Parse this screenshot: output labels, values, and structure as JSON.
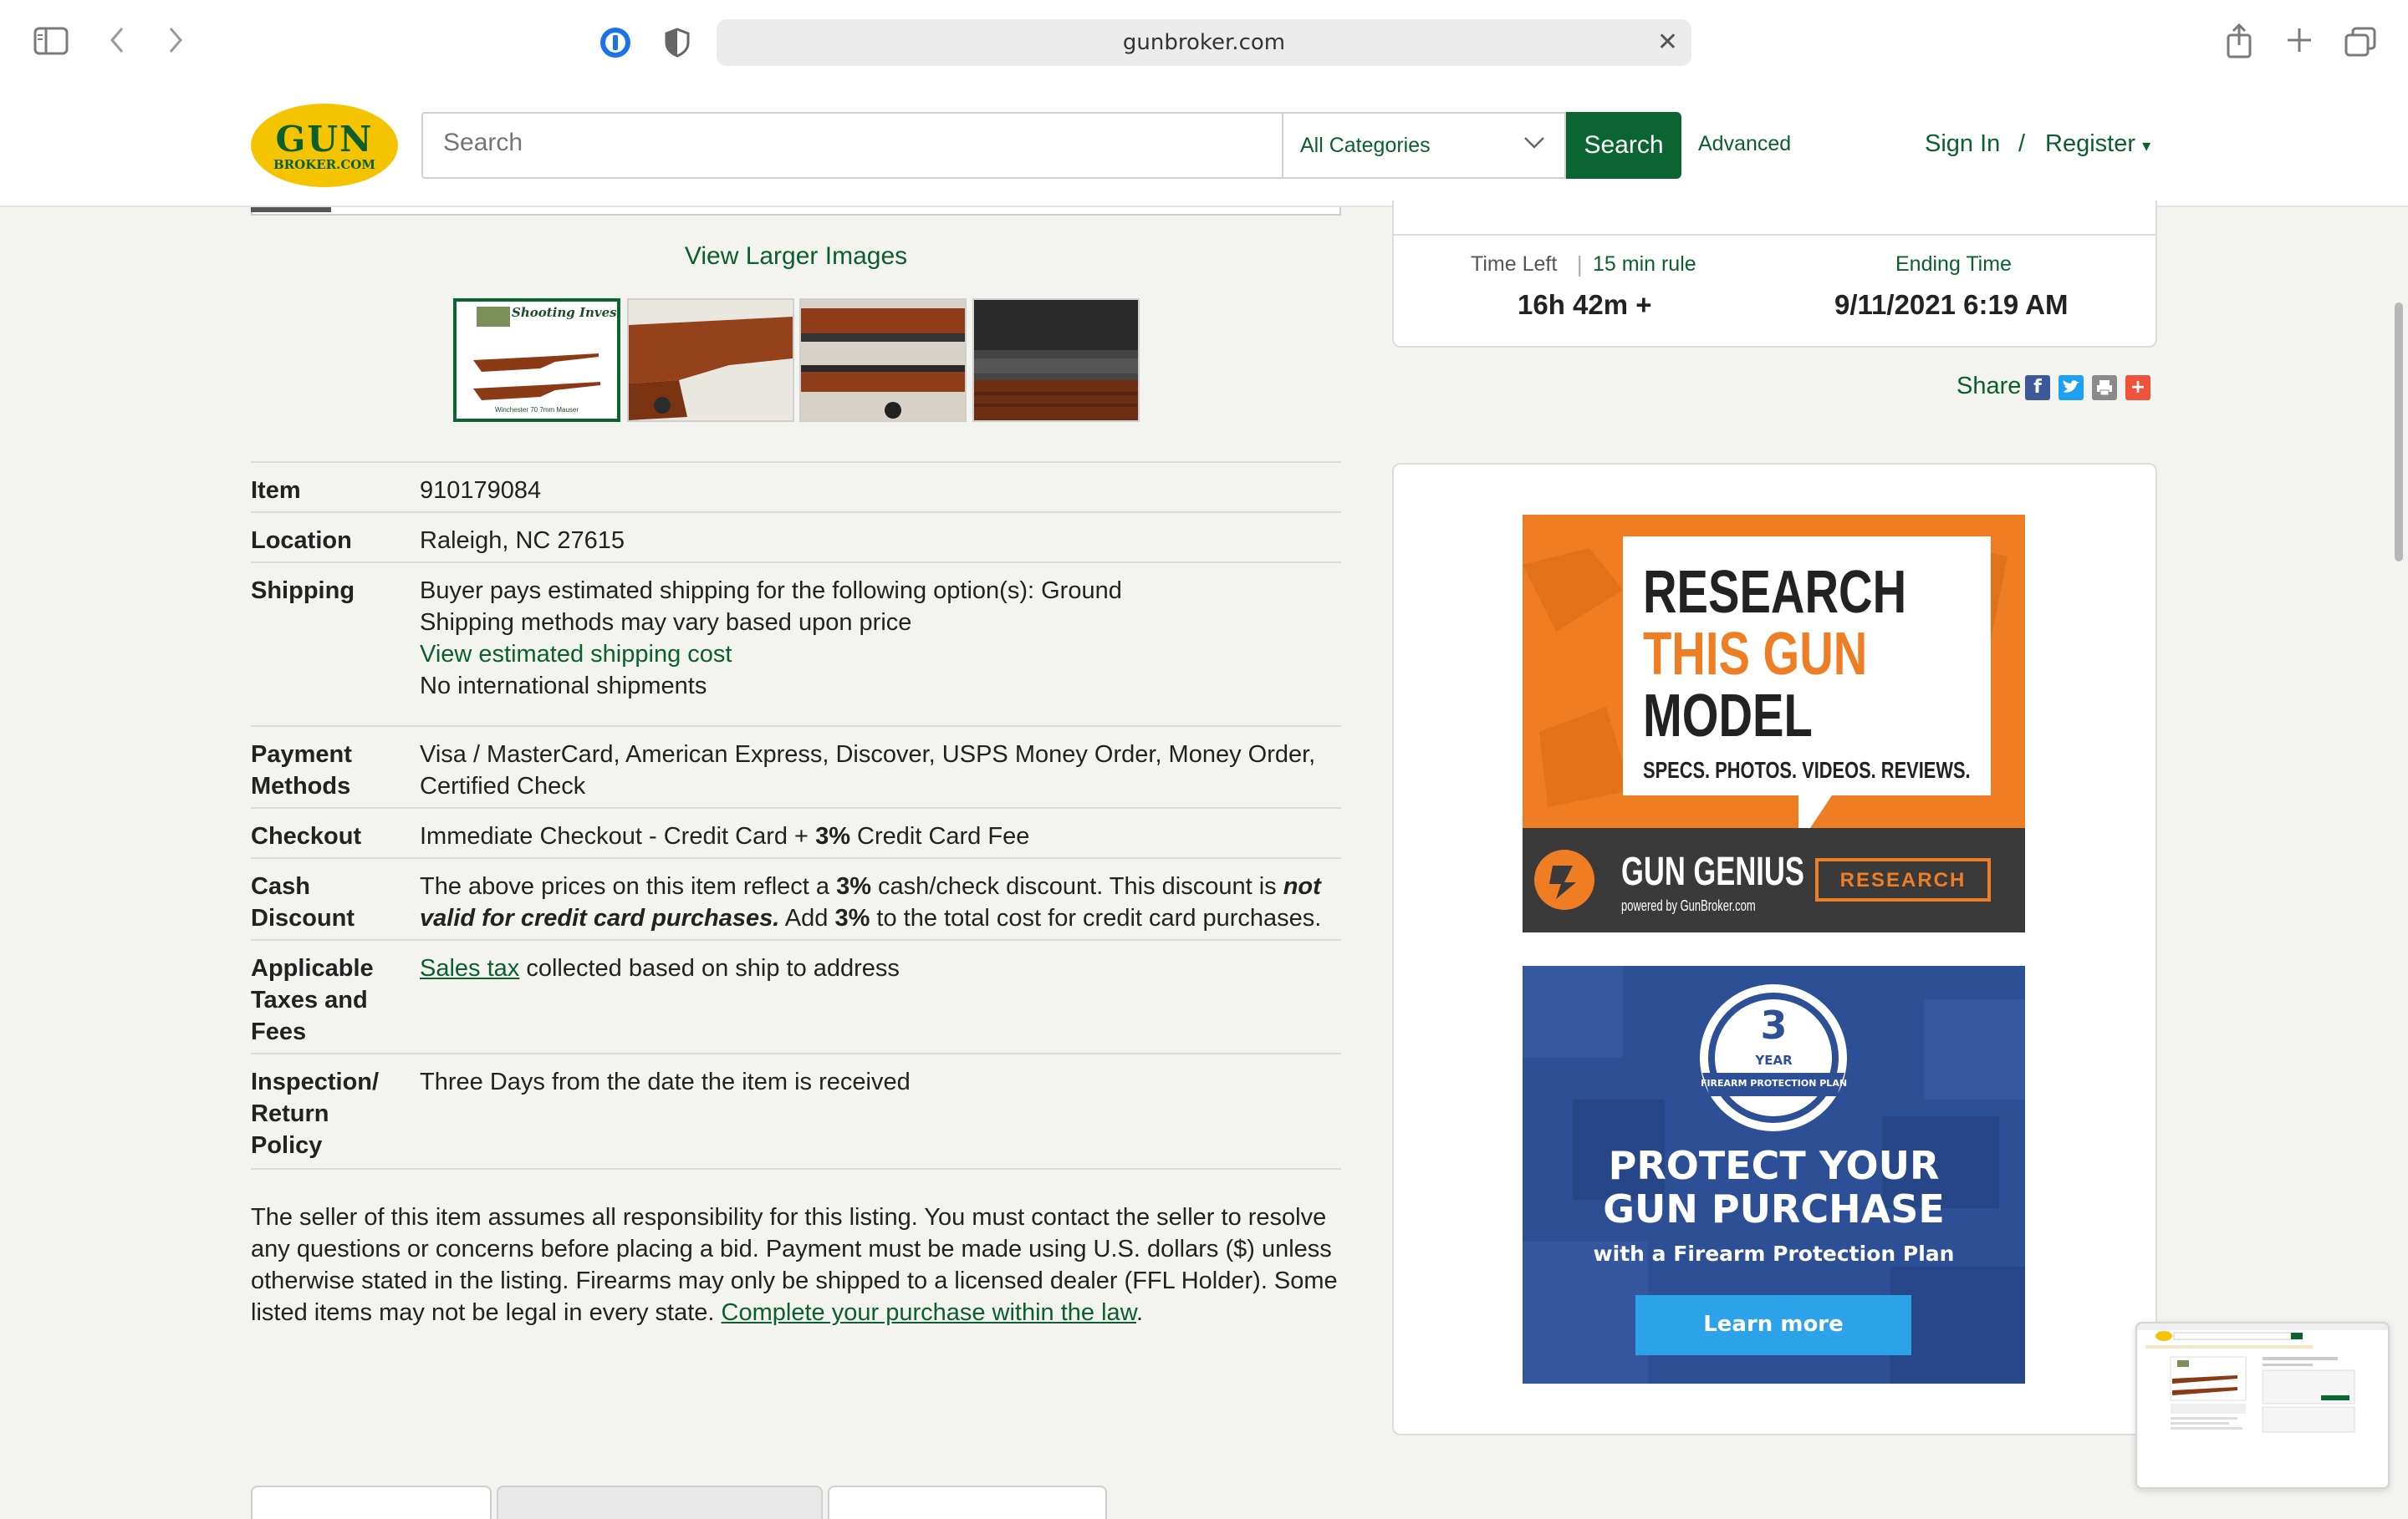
{
  "browser": {
    "url": "gunbroker.com"
  },
  "site": {
    "logo_line1": "GUN",
    "logo_line2": "BROKER.COM",
    "search_placeholder": "Search",
    "category_selected": "All Categories",
    "search_button": "Search",
    "advanced_link": "Advanced",
    "sign_in": "Sign In",
    "separator": "/",
    "register": "Register"
  },
  "gallery": {
    "view_larger": "View Larger Images",
    "thumb1_title": "Shooting Investments",
    "thumb1_caption": "Winchester 70 7mm Mauser"
  },
  "details": [
    {
      "label": "Item",
      "value": "910179084"
    },
    {
      "label": "Location",
      "value": "Raleigh, NC 27615"
    },
    {
      "label": "Shipping",
      "line1": "Buyer pays estimated shipping for the following option(s): Ground",
      "line2": "Shipping methods may vary based upon price",
      "link": "View estimated shipping cost",
      "line4": "No international shipments"
    },
    {
      "label1": "Payment",
      "label2": "Methods",
      "line1": "Visa / MasterCard, American Express, Discover, USPS Money Order, Money Order,",
      "line2": "Certified Check"
    },
    {
      "label": "Checkout",
      "pre": "Immediate Checkout - Credit Card + ",
      "bold": "3%",
      "post": " Credit Card Fee"
    },
    {
      "label1": "Cash",
      "label2": "Discount",
      "t1": "The above prices on this item reflect a ",
      "b1": "3%",
      "t2": " cash/check discount. This discount is ",
      "i1": "not",
      "i2": "valid for credit card purchases.",
      "t3": " Add ",
      "b2": "3%",
      "t4": " to the total cost for credit card purchases."
    },
    {
      "label1": "Applicable",
      "label2": "Taxes and",
      "label3": "Fees",
      "link": "Sales tax",
      "text": " collected based on ship to address"
    },
    {
      "label1": "Inspection/",
      "label2": "Return",
      "label3": "Policy",
      "value": "Three Days from the date the item is received"
    }
  ],
  "disclaimer": {
    "text": "The seller of this item assumes all responsibility for this listing. You must contact the seller to resolve any questions or concerns before placing a bid. Payment must be made using U.S. dollars ($) unless otherwise stated in the listing. Firearms may only be shipped to a licensed dealer (FFL Holder). Some listed items may not be legal in every state. ",
    "link": "Complete your purchase within the law",
    "end": "."
  },
  "timing": {
    "time_left_label": "Time Left",
    "rule_label": "15 min rule",
    "time_left_value": "16h 42m +",
    "ending_label": "Ending Time",
    "ending_value": "9/11/2021 6:19 AM"
  },
  "share": {
    "label": "Share"
  },
  "ads": {
    "ad1_line1": "RESEARCH",
    "ad1_line2": "THIS GUN",
    "ad1_line3": "MODEL",
    "ad1_line4": "SPECS. PHOTOS. VIDEOS. REVIEWS.",
    "ad1_brand": "GUN GENIUS",
    "ad1_powered": "powered by GunBroker.com",
    "ad1_button": "RESEARCH",
    "ad2_badge_num": "3",
    "ad2_badge_year": "YEAR",
    "ad2_badge_text": "FIREARM PROTECTION PLAN",
    "ad2_line1": "PROTECT YOUR",
    "ad2_line2": "GUN PURCHASE",
    "ad2_line3": "with a Firearm Protection Plan",
    "ad2_button": "Learn more"
  }
}
